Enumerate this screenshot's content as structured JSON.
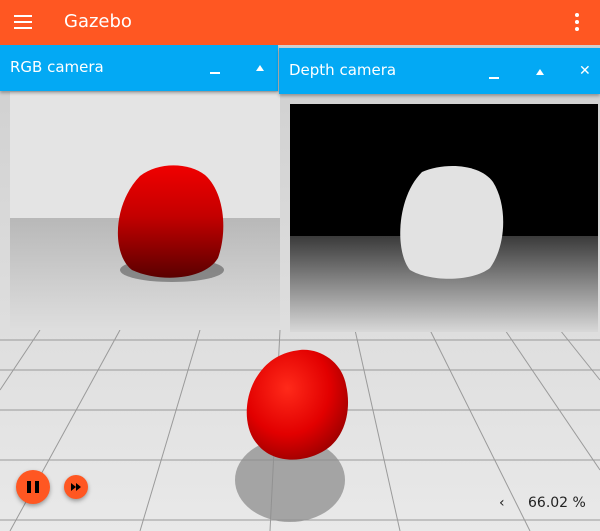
{
  "app": {
    "title": "Gazebo"
  },
  "icons": {
    "menu": "hamburger-menu-icon",
    "more": "more-vert-icon",
    "play_pause": "pause-icon",
    "step": "fast-forward-icon",
    "stats_toggle": "chevron-left-icon"
  },
  "colors": {
    "toolbar": "#ff5722",
    "panel_header": "#03a9f4",
    "object": "#e00000",
    "depth_bg": "#000000",
    "depth_object": "#e6e6e6"
  },
  "panels": {
    "rgb": {
      "title": "RGB camera",
      "minimize_icon": "minimize-icon",
      "collapse_icon": "collapse-icon"
    },
    "depth": {
      "title": "Depth camera",
      "minimize_icon": "minimize-icon",
      "collapse_icon": "collapse-icon",
      "close_icon": "close-icon"
    }
  },
  "stats": {
    "real_time_factor": "66.02 %"
  }
}
